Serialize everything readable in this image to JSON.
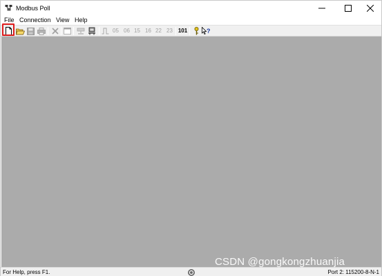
{
  "window": {
    "title": "Modbus Poll"
  },
  "menu": {
    "file": "File",
    "connection": "Connection",
    "view": "View",
    "help": "Help"
  },
  "toolbar": {
    "fc_buttons": [
      "05",
      "06",
      "15",
      "16",
      "22",
      "23"
    ],
    "read_label": "101"
  },
  "status": {
    "help_text": "For Help, press F1.",
    "port_text": "Port 2: 115200-8-N-1"
  },
  "watermark": {
    "text": "CSDN @gongkongzhuanjia"
  },
  "colors": {
    "client_background": "#ababab",
    "highlight": "#e01c1c"
  }
}
